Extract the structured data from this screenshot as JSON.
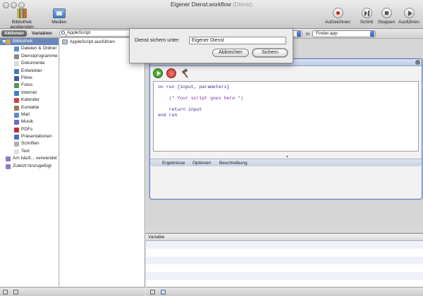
{
  "window": {
    "title": "Eigener Dienst.workflow",
    "title_suffix": "(Dienst)"
  },
  "toolbar": {
    "hide_library_label": "Bibliothek ausblenden",
    "media_label": "Medien",
    "record_label": "Aufzeichnen",
    "step_label": "Schritt",
    "stop_label": "Stoppen",
    "run_label": "Ausführen"
  },
  "library": {
    "tab_actions": "Aktionen",
    "tab_variables": "Variablen",
    "search_value": "AppleScript",
    "root_label": "Bibliothek",
    "items": [
      {
        "label": "Dateien & Ordner",
        "color": "#5b8fd6"
      },
      {
        "label": "Dienstprogramme",
        "color": "#8a8a8a"
      },
      {
        "label": "Dokumente",
        "color": "#d9d9d9"
      },
      {
        "label": "Entwickler",
        "color": "#4a7bc0"
      },
      {
        "label": "Filme",
        "color": "#3a5fa8"
      },
      {
        "label": "Fotos",
        "color": "#4a9a4a"
      },
      {
        "label": "Internet",
        "color": "#3b7fd0"
      },
      {
        "label": "Kalender",
        "color": "#d04040"
      },
      {
        "label": "Kontakte",
        "color": "#9a7a4a"
      },
      {
        "label": "Mail",
        "color": "#5a8ad0"
      },
      {
        "label": "Musik",
        "color": "#6a6ad0"
      },
      {
        "label": "PDFs",
        "color": "#c03030"
      },
      {
        "label": "Präsentationen",
        "color": "#4a70c0"
      },
      {
        "label": "Schriften",
        "color": "#b0b0b0"
      },
      {
        "label": "Text",
        "color": "#e0e0e0"
      }
    ],
    "frequent_label": "Am häufi... verwendet",
    "recent_label": "Zuletzt hinzugefügt"
  },
  "actions_list": {
    "items": [
      "AppleScript ausführen"
    ]
  },
  "run_row": {
    "in_label": "in",
    "app_value": "Finder.app"
  },
  "action": {
    "code_lines": [
      {
        "text": "on run {input, parameters}",
        "kind": "kw"
      },
      {
        "text": "",
        "kind": "plain"
      },
      {
        "text": "    (* Your script goes here *)",
        "kind": "cmt"
      },
      {
        "text": "",
        "kind": "plain"
      },
      {
        "text": "    return input",
        "kind": "kw"
      },
      {
        "text": "end run",
        "kind": "kw"
      }
    ],
    "tab_results": "Ergebnisse",
    "tab_options": "Optionen",
    "tab_description": "Beschreibung"
  },
  "variables": {
    "header": "Variable"
  },
  "dialog": {
    "label": "Dienst sichern unter:",
    "input_value": "Eigener Dienst",
    "cancel_label": "Abbrechen",
    "save_label": "Sichern"
  },
  "colors": {
    "selection": "#6b87ba",
    "record_red": "#d62020",
    "run_green": "#2c8a1a"
  }
}
